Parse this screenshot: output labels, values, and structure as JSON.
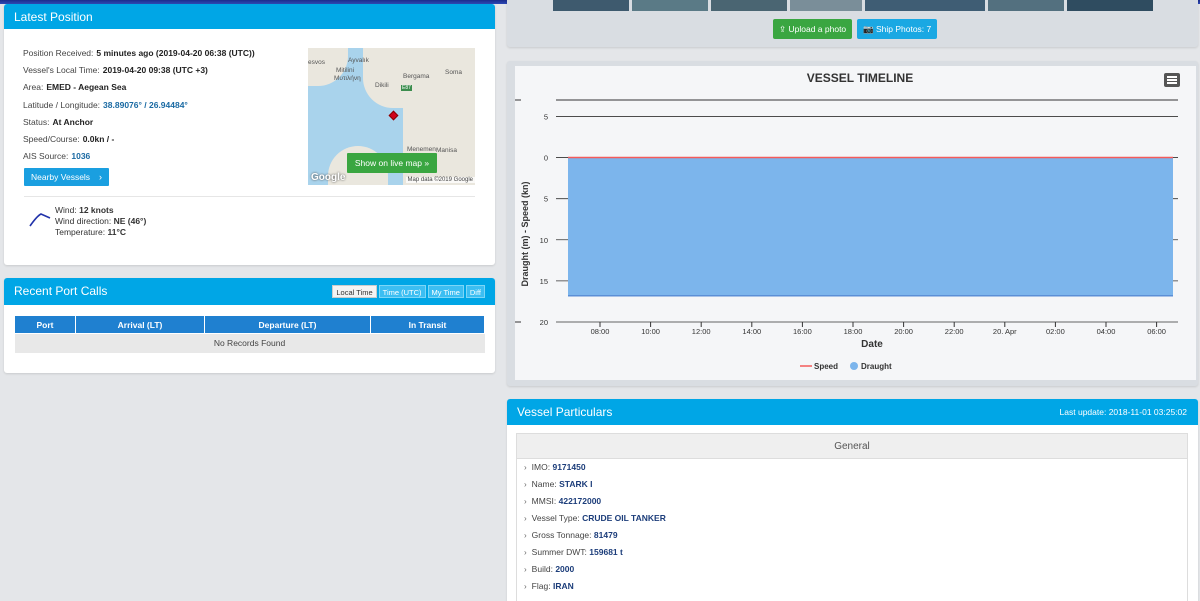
{
  "latest_position": {
    "title": "Latest Position",
    "rows": [
      {
        "label": "Position Received:",
        "value": "5 minutes ago (2019-04-20 06:38 (UTC))"
      },
      {
        "label": "Vessel's Local Time:",
        "value": "2019-04-20 09:38 (UTC +3)"
      },
      {
        "label": "Area:",
        "value": "EMED - Aegean Sea"
      },
      {
        "label": "Latitude / Longitude:",
        "value": "38.89076° / 26.94484°"
      },
      {
        "label": "Status:",
        "value": "At Anchor"
      },
      {
        "label": "Speed/Course:",
        "value": "0.0kn / -"
      },
      {
        "label": "AIS Source:",
        "value": "1036"
      }
    ],
    "nearby_button": "Nearby Vessels",
    "wind_label": "Wind:",
    "wind_value": "12  knots",
    "wind_dir_label": "Wind direction:",
    "wind_dir_value": "NE (46°)",
    "temp_label": "Temperature:",
    "temp_value": "11°C",
    "map": {
      "labels": [
        "esvos",
        "Ayvalık",
        "Mitilini",
        "Μυτιλήνη",
        "Dikili",
        "Bergama",
        "Soma",
        "E87",
        "Menemen",
        "Manisa"
      ],
      "live_map_button": "Show on live map",
      "google": "Google",
      "attribution": "Map data ©2019 Google"
    }
  },
  "port_calls": {
    "title": "Recent Port Calls",
    "time_buttons": [
      "Local Time",
      "Time (UTC)",
      "My Time",
      "Diff"
    ],
    "headers": [
      "Port",
      "Arrival (LT)",
      "Departure (LT)",
      "In Transit"
    ],
    "empty_message": "No Records Found"
  },
  "photos": {
    "upload_button": "Upload a photo",
    "ship_photos_button": "Ship Photos: 7"
  },
  "chart_data": {
    "type": "area",
    "title": "VESSEL TIMELINE",
    "xlabel": "Date",
    "ylabel": "Draught (m) - Speed (kn)",
    "x_ticks": [
      "08:00",
      "10:00",
      "12:00",
      "14:00",
      "16:00",
      "18:00",
      "20:00",
      "22:00",
      "20. Apr",
      "02:00",
      "04:00",
      "06:00"
    ],
    "y_ticks": [
      "5",
      "0",
      "5",
      "10",
      "15",
      "20"
    ],
    "y_tick_values": [
      5,
      0,
      -5,
      -10,
      -15,
      -20
    ],
    "ylim": [
      -20,
      7
    ],
    "series": [
      {
        "name": "Speed",
        "color": "#f45b5b",
        "x_hours": [
          0,
          23.8
        ],
        "values": [
          0,
          0
        ]
      },
      {
        "name": "Draught",
        "color": "#7cb5ec",
        "x_hours": [
          0,
          23.8
        ],
        "values": [
          -16.8,
          -16.8
        ]
      }
    ],
    "legend": [
      "Speed",
      "Draught"
    ],
    "legend_position": "bottom-center"
  },
  "particulars": {
    "title": "Vessel Particulars",
    "last_update": "Last update: 2018-11-01 03:25:02",
    "section_title": "General",
    "rows": [
      {
        "label": "IMO:",
        "value": "9171450"
      },
      {
        "label": "Name:",
        "value": "STARK I"
      },
      {
        "label": "MMSI:",
        "value": "422172000"
      },
      {
        "label": "Vessel Type:",
        "value": "CRUDE OIL TANKER"
      },
      {
        "label": "Gross Tonnage:",
        "value": "81479"
      },
      {
        "label": "Summer DWT:",
        "value": "159681 t"
      },
      {
        "label": "Build:",
        "value": "2000"
      },
      {
        "label": "Flag:",
        "value": "IRAN"
      }
    ]
  },
  "colors": {
    "accent": "#00a6e6",
    "button_blue": "#1a9fe0",
    "button_green": "#3aa641",
    "table_header": "#1f80d0"
  }
}
